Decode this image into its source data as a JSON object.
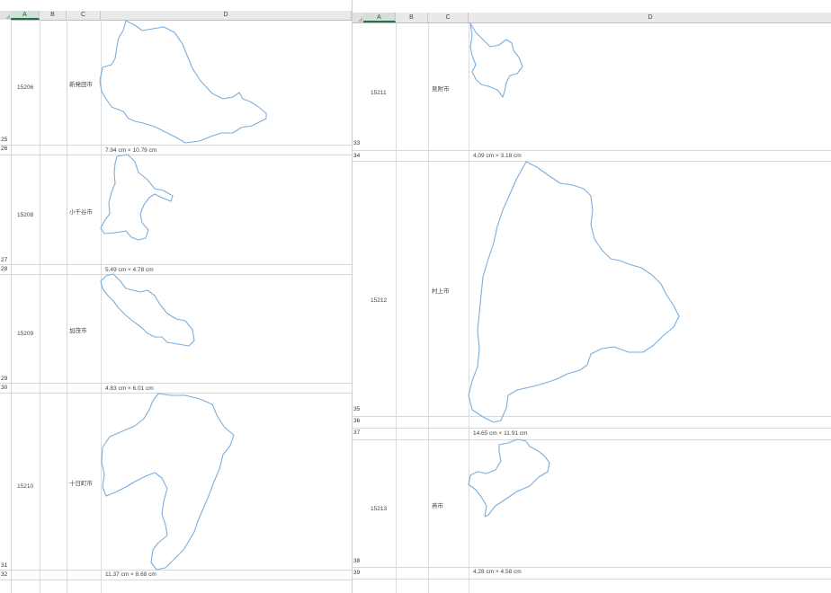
{
  "columns_left": [
    "A",
    "B",
    "C",
    "D"
  ],
  "columns_right": [
    "A",
    "B",
    "C",
    "D"
  ],
  "row_numbers_left": [
    "25",
    "26",
    "27",
    "28",
    "29",
    "30",
    "31",
    "32"
  ],
  "row_numbers_right": [
    "33",
    "34",
    "35",
    "36",
    "37",
    "38",
    "39"
  ],
  "left_records": [
    {
      "code": "15206",
      "name": "新発田市",
      "size": "7.94 cm × 10.79 cm"
    },
    {
      "code": "15208",
      "name": "小千谷市",
      "size": "5.49 cm × 4.78 cm"
    },
    {
      "code": "15209",
      "name": "加茂市",
      "size": "4.83 cm × 6.01 cm"
    },
    {
      "code": "15210",
      "name": "十日町市",
      "size": "11.37 cm × 8.68 cm"
    }
  ],
  "right_records": [
    {
      "code": "15211",
      "name": "見附市",
      "size": "4.09 cm × 3.18 cm"
    },
    {
      "code": "15212",
      "name": "村上市",
      "size": "14.65 cm × 11.91 cm"
    },
    {
      "code": "15213",
      "name": "燕市",
      "size": "4.28 cm × 4.58 cm"
    }
  ],
  "colors": {
    "outline": "#7aaede",
    "header_bg": "#e9e9e9",
    "selected_header": "#217346"
  }
}
